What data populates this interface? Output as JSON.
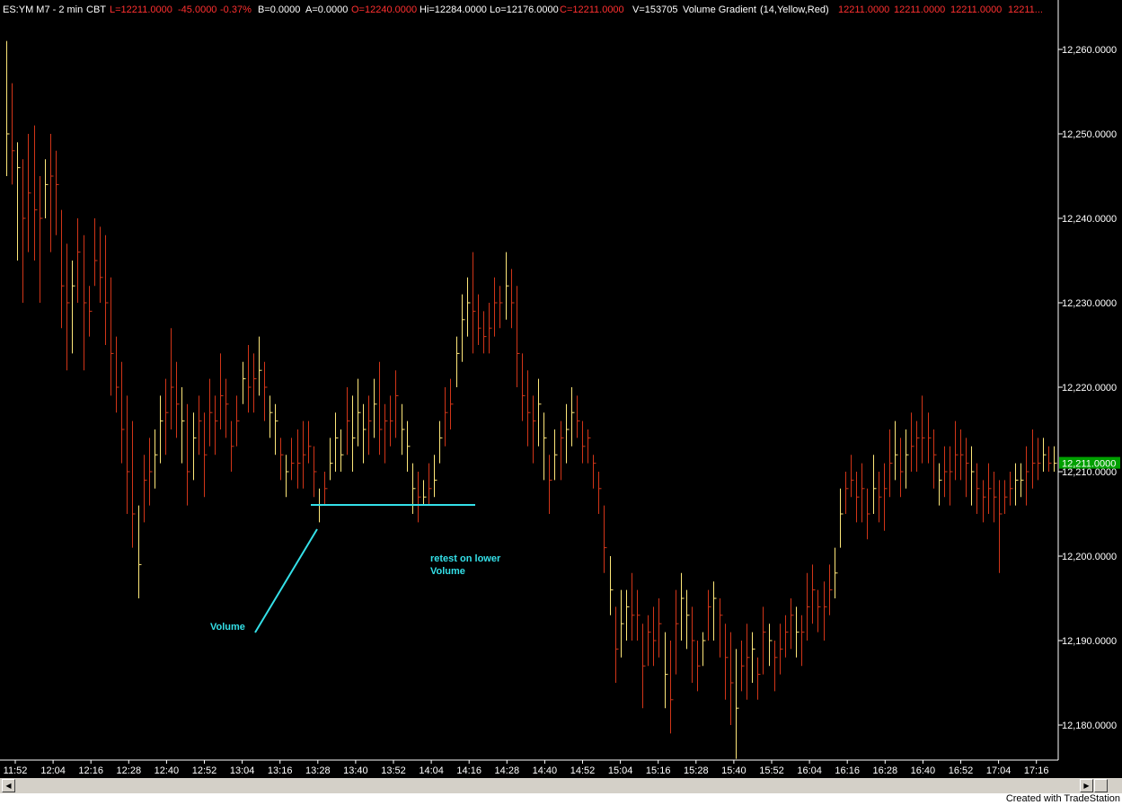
{
  "header": {
    "symbol": "ES:YM M7 - 2 min",
    "exchange": "CBT",
    "last": "L=12211.0000",
    "change": "-45.0000",
    "change_pct": "-0.37%",
    "bid": "B=0.0000",
    "ask": "A=0.0000",
    "open": "O=12240.0000",
    "high": "Hi=12284.0000",
    "low": "Lo=12176.0000",
    "close": "C=12211.0000",
    "volume": "V=153705",
    "indicator": "Volume Gradient",
    "indicator_params": "(14,Yellow,Red)",
    "indicator_vals": [
      "12211.0000",
      "12211.0000",
      "12211.0000",
      "12211..."
    ]
  },
  "annotations": {
    "volume_label": "Volume",
    "retest_line1": "retest on lower",
    "retest_line2": "Volume"
  },
  "last_price_label": "12,211.0000",
  "footer": {
    "credit": "Created with TradeStation"
  },
  "colors": {
    "background": "#000000",
    "axis": "#ffffff",
    "bar_low_volume": "#ffe87a",
    "bar_high_volume": "#d23518",
    "annotation": "#34e0e8",
    "last_price_box": "#00a000",
    "header_green": "#00ff00",
    "header_red": "#ff3030",
    "header_white": "#ffffff"
  },
  "chart_data": {
    "type": "ohlc",
    "title": "",
    "xlabel": "",
    "ylabel": "",
    "ylim": [
      12175,
      12265
    ],
    "grid": false,
    "y_ticks": [
      "12,260.0000",
      "12,250.0000",
      "12,240.0000",
      "12,230.0000",
      "12,220.0000",
      "12,210.0000",
      "12,200.0000",
      "12,190.0000",
      "12,180.0000"
    ],
    "y_tick_values": [
      12260,
      12250,
      12240,
      12230,
      12220,
      12210,
      12200,
      12190,
      12180
    ],
    "x_ticks": [
      "11:52",
      "12:04",
      "12:16",
      "12:28",
      "12:40",
      "12:52",
      "13:04",
      "13:16",
      "13:28",
      "13:40",
      "13:52",
      "14:04",
      "14:16",
      "14:28",
      "14:40",
      "14:52",
      "15:04",
      "15:16",
      "15:28",
      "15:40",
      "15:52",
      "16:04",
      "16:16",
      "16:28",
      "16:40",
      "16:52",
      "17:04",
      "17:16"
    ],
    "bars_hlc": [
      [
        12261,
        12245,
        12250
      ],
      [
        12256,
        12244,
        12248
      ],
      [
        12249,
        12235,
        12246
      ],
      [
        12247,
        12230,
        12240
      ],
      [
        12250,
        12236,
        12243
      ],
      [
        12251,
        12235,
        12241
      ],
      [
        12245,
        12230,
        12240
      ],
      [
        12247,
        12240,
        12244
      ],
      [
        12250,
        12236,
        12245
      ],
      [
        12248,
        12238,
        12244
      ],
      [
        12241,
        12227,
        12232
      ],
      [
        12237,
        12222,
        12230
      ],
      [
        12235,
        12224,
        12232
      ],
      [
        12240,
        12230,
        12236
      ],
      [
        12238,
        12222,
        12230
      ],
      [
        12232,
        12226,
        12229
      ],
      [
        12240,
        12232,
        12235
      ],
      [
        12239,
        12230,
        12233
      ],
      [
        12238,
        12225,
        12230
      ],
      [
        12233,
        12219,
        12224
      ],
      [
        12226,
        12217,
        12220
      ],
      [
        12223,
        12211,
        12215
      ],
      [
        12219,
        12205,
        12210
      ],
      [
        12216,
        12201,
        12205
      ],
      [
        12206,
        12195,
        12199
      ],
      [
        12212,
        12204,
        12209
      ],
      [
        12214,
        12206,
        12210
      ],
      [
        12215,
        12208,
        12212
      ],
      [
        12219,
        12211,
        12216
      ],
      [
        12221,
        12212,
        12217
      ],
      [
        12227,
        12215,
        12220
      ],
      [
        12223,
        12214,
        12218
      ],
      [
        12220,
        12211,
        12216
      ],
      [
        12218,
        12206,
        12210
      ],
      [
        12217,
        12209,
        12214
      ],
      [
        12219,
        12212,
        12216
      ],
      [
        12217,
        12207,
        12212
      ],
      [
        12221,
        12213,
        12217
      ],
      [
        12219,
        12212,
        12216
      ],
      [
        12224,
        12215,
        12219
      ],
      [
        12221,
        12214,
        12218
      ],
      [
        12216,
        12210,
        12213
      ],
      [
        12219,
        12213,
        12216
      ],
      [
        12223,
        12218,
        12221
      ],
      [
        12225,
        12217,
        12220
      ],
      [
        12224,
        12217,
        12221
      ],
      [
        12226,
        12219,
        12222
      ],
      [
        12223,
        12216,
        12220
      ],
      [
        12219,
        12214,
        12217
      ],
      [
        12218,
        12212,
        12216
      ],
      [
        12214,
        12209,
        12212
      ],
      [
        12212,
        12207,
        12210
      ],
      [
        12214,
        12209,
        12211
      ],
      [
        12215,
        12208,
        12211
      ],
      [
        12216,
        12208,
        12212
      ],
      [
        12216,
        12211,
        12213
      ],
      [
        12213,
        12207,
        12210
      ],
      [
        12208,
        12204,
        12206
      ],
      [
        12210,
        12206,
        12208
      ],
      [
        12214,
        12209,
        12211
      ],
      [
        12217,
        12210,
        12214
      ],
      [
        12215,
        12210,
        12212
      ],
      [
        12220,
        12212,
        12216
      ],
      [
        12219,
        12210,
        12214
      ],
      [
        12221,
        12213,
        12217
      ],
      [
        12218,
        12211,
        12215
      ],
      [
        12219,
        12212,
        12216
      ],
      [
        12221,
        12214,
        12218
      ],
      [
        12223,
        12212,
        12215
      ],
      [
        12218,
        12211,
        12216
      ],
      [
        12219,
        12213,
        12216
      ],
      [
        12222,
        12214,
        12219
      ],
      [
        12218,
        12212,
        12215
      ],
      [
        12216,
        12210,
        12213
      ],
      [
        12211,
        12205,
        12208
      ],
      [
        12210,
        12204,
        12207
      ],
      [
        12209,
        12206,
        12207
      ],
      [
        12211,
        12206,
        12208
      ],
      [
        12212,
        12207,
        12209
      ],
      [
        12216,
        12211,
        12214
      ],
      [
        12220,
        12213,
        12217
      ],
      [
        12221,
        12215,
        12218
      ],
      [
        12226,
        12220,
        12224
      ],
      [
        12231,
        12223,
        12228
      ],
      [
        12233,
        12226,
        12230
      ],
      [
        12236,
        12224,
        12229
      ],
      [
        12231,
        12225,
        12227
      ],
      [
        12229,
        12224,
        12226
      ],
      [
        12230,
        12224,
        12227
      ],
      [
        12233,
        12226,
        12230
      ],
      [
        12232,
        12227,
        12230
      ],
      [
        12236,
        12228,
        12232
      ],
      [
        12234,
        12227,
        12230
      ],
      [
        12232,
        12220,
        12224
      ],
      [
        12224,
        12216,
        12219
      ],
      [
        12222,
        12213,
        12217
      ],
      [
        12219,
        12211,
        12216
      ],
      [
        12221,
        12213,
        12218
      ],
      [
        12217,
        12209,
        12214
      ],
      [
        12212,
        12205,
        12209
      ],
      [
        12215,
        12209,
        12212
      ],
      [
        12216,
        12209,
        12214
      ],
      [
        12218,
        12211,
        12215
      ],
      [
        12220,
        12213,
        12217
      ],
      [
        12219,
        12214,
        12216
      ],
      [
        12216,
        12211,
        12213
      ],
      [
        12215,
        12211,
        12214
      ],
      [
        12212,
        12208,
        12211
      ],
      [
        12210,
        12205,
        12208
      ],
      [
        12206,
        12198,
        12201
      ],
      [
        12200,
        12193,
        12196
      ],
      [
        12194,
        12185,
        12189
      ],
      [
        12196,
        12188,
        12192
      ],
      [
        12196,
        12190,
        12194
      ],
      [
        12198,
        12190,
        12193
      ],
      [
        12196,
        12190,
        12193
      ],
      [
        12192,
        12182,
        12187
      ],
      [
        12193,
        12187,
        12191
      ],
      [
        12194,
        12187,
        12190
      ],
      [
        12195,
        12188,
        12192
      ],
      [
        12191,
        12182,
        12186
      ],
      [
        12190,
        12179,
        12183
      ],
      [
        12196,
        12186,
        12192
      ],
      [
        12198,
        12190,
        12195
      ],
      [
        12196,
        12189,
        12193
      ],
      [
        12194,
        12185,
        12190
      ],
      [
        12190,
        12184,
        12187
      ],
      [
        12191,
        12187,
        12190
      ],
      [
        12196,
        12190,
        12194
      ],
      [
        12197,
        12190,
        12195
      ],
      [
        12195,
        12188,
        12193
      ],
      [
        12192,
        12183,
        12188
      ],
      [
        12191,
        12180,
        12185
      ],
      [
        12189,
        12176,
        12182
      ],
      [
        12190,
        12184,
        12187
      ],
      [
        12192,
        12183,
        12188
      ],
      [
        12191,
        12185,
        12189
      ],
      [
        12188,
        12183,
        12186
      ],
      [
        12194,
        12186,
        12191
      ],
      [
        12192,
        12187,
        12190
      ],
      [
        12190,
        12184,
        12188
      ],
      [
        12192,
        12186,
        12189
      ],
      [
        12193,
        12188,
        12191
      ],
      [
        12195,
        12189,
        12193
      ],
      [
        12194,
        12188,
        12191
      ],
      [
        12193,
        12187,
        12191
      ],
      [
        12198,
        12190,
        12194
      ],
      [
        12199,
        12192,
        12196
      ],
      [
        12196,
        12191,
        12194
      ],
      [
        12197,
        12190,
        12194
      ],
      [
        12199,
        12193,
        12196
      ],
      [
        12201,
        12195,
        12198
      ],
      [
        12208,
        12201,
        12205
      ],
      [
        12210,
        12205,
        12208
      ],
      [
        12212,
        12207,
        12209
      ],
      [
        12210,
        12204,
        12207
      ],
      [
        12211,
        12204,
        12208
      ],
      [
        12208,
        12202,
        12205
      ],
      [
        12212,
        12205,
        12208
      ],
      [
        12210,
        12204,
        12207
      ],
      [
        12211,
        12203,
        12208
      ],
      [
        12215,
        12207,
        12211
      ],
      [
        12216,
        12209,
        12212
      ],
      [
        12214,
        12207,
        12210
      ],
      [
        12215,
        12208,
        12212
      ],
      [
        12217,
        12210,
        12213
      ],
      [
        12216,
        12210,
        12214
      ],
      [
        12219,
        12211,
        12214
      ],
      [
        12217,
        12211,
        12214
      ],
      [
        12215,
        12208,
        12212
      ],
      [
        12211,
        12206,
        12209
      ],
      [
        12213,
        12207,
        12210
      ],
      [
        12213,
        12206,
        12210
      ],
      [
        12216,
        12209,
        12212
      ],
      [
        12215,
        12209,
        12212
      ],
      [
        12214,
        12207,
        12211
      ],
      [
        12213,
        12206,
        12210
      ],
      [
        12211,
        12205,
        12208
      ],
      [
        12209,
        12204,
        12207
      ],
      [
        12211,
        12205,
        12208
      ],
      [
        12210,
        12204,
        12207
      ],
      [
        12209,
        12198,
        12205
      ],
      [
        12209,
        12205,
        12207
      ],
      [
        12210,
        12206,
        12208
      ],
      [
        12211,
        12206,
        12209
      ],
      [
        12211,
        12207,
        12209
      ],
      [
        12213,
        12206,
        12210
      ],
      [
        12215,
        12208,
        12211
      ],
      [
        12214,
        12209,
        12211
      ],
      [
        12214,
        12210,
        12212
      ],
      [
        12213,
        12210,
        12211
      ],
      [
        12213,
        12210,
        12211
      ]
    ],
    "last_price": 12211
  }
}
